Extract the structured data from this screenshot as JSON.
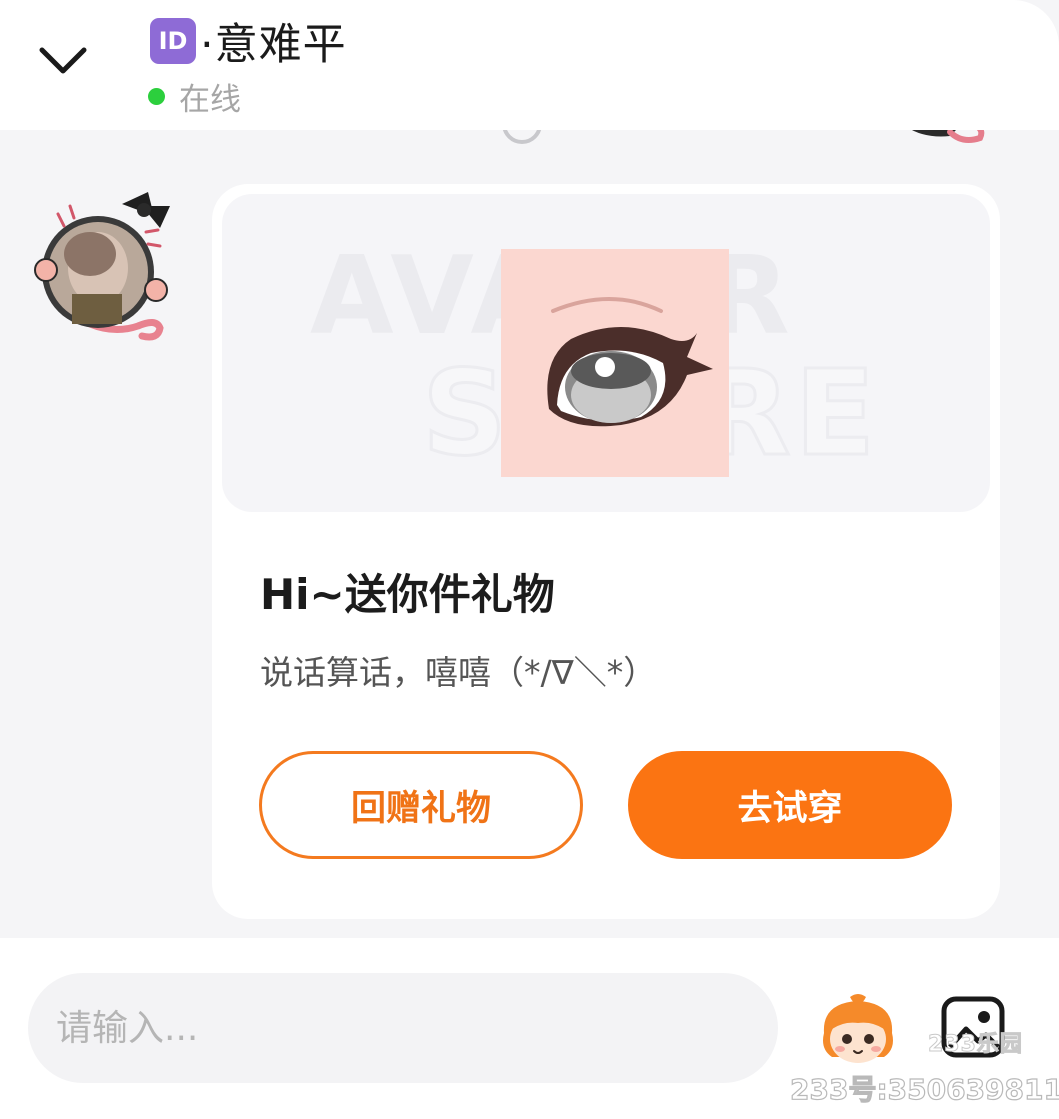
{
  "header": {
    "id_badge": "ID",
    "title": "·意难平",
    "status": "在线"
  },
  "card": {
    "watermark_line1": "AVATAR",
    "watermark_line2": "STORE",
    "title": "Hi~送你件礼物",
    "description": "说话算话，嘻嘻（*/∇＼*）",
    "return_gift_label": "回赠礼物",
    "try_on_label": "去试穿"
  },
  "input": {
    "placeholder": "请输入..."
  },
  "watermark": {
    "logo": "233乐园",
    "id_text": "233号:350639811"
  },
  "colors": {
    "accent": "#fb7412",
    "online": "#2ccf3d",
    "id_badge": "#8e6bd6"
  }
}
